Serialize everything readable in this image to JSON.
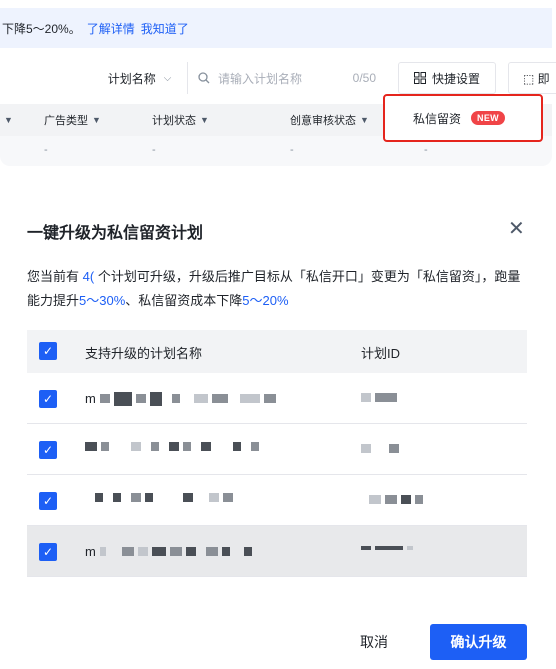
{
  "notice": {
    "text": "下降5～20%。",
    "learn_more": "了解详情",
    "dismiss": "我知道了"
  },
  "toolbar": {
    "plan_select_label": "计划名称",
    "search_placeholder": "请输入计划名称",
    "search_count": "0/50",
    "quick_settings_label": "快捷设置",
    "other_button_label": "[]"
  },
  "table": {
    "columns": [
      "广告类型",
      "计划状态",
      "创意审核状态"
    ],
    "row_values": [
      "-",
      "-",
      "-",
      "-",
      "-"
    ]
  },
  "dropdown": {
    "item_label": "私信留资",
    "badge": "NEW"
  },
  "modal": {
    "title": "一键升级为私信留资计划",
    "desc_part1": "您当前有",
    "desc_count": "4(",
    "desc_part2": "个计划可升级，升级后推广目标从「私信开口」变更为「私信留资」，跑量能力提升",
    "desc_pct1": "5～30%",
    "desc_part3": "、私信留资成本下降",
    "desc_pct2": "5～20%",
    "list_header_name": "支持升级的计划名称",
    "list_header_id": "计划ID",
    "rows": [
      {
        "name_prefix": "m"
      },
      {
        "name_prefix": ""
      },
      {
        "name_prefix": ""
      },
      {
        "name_prefix": "m"
      }
    ],
    "cancel_label": "取消",
    "confirm_label": "确认升级"
  },
  "icons": {
    "checkbox": "check-icon",
    "close": "close-icon",
    "search": "search-icon",
    "filter": "filter-icon",
    "quick": "grid-icon"
  },
  "colors": {
    "accent": "#1d5ff5",
    "highlight_border": "#e5251d",
    "badge": "#f04447"
  }
}
